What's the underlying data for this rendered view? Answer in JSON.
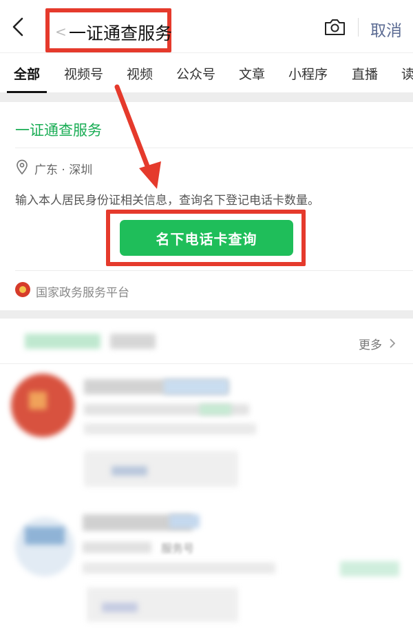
{
  "topbar": {
    "query_mini": "<",
    "query": "一证通查服务",
    "cancel": "取消",
    "icons": [
      "back-icon",
      "camera-icon"
    ]
  },
  "tabs": [
    {
      "label": "全部",
      "active": true
    },
    {
      "label": "视频号",
      "active": false
    },
    {
      "label": "视频",
      "active": false
    },
    {
      "label": "公众号",
      "active": false
    },
    {
      "label": "文章",
      "active": false
    },
    {
      "label": "小程序",
      "active": false
    },
    {
      "label": "直播",
      "active": false
    },
    {
      "label": "读",
      "active": false
    }
  ],
  "service_card": {
    "title": "一证通查服务",
    "location": "广东 · 深圳",
    "description": "输入本人居民身份证相关信息，查询名下登记电话卡数量。",
    "cta": "名下电话卡查询",
    "provider": "国家政务服务平台"
  },
  "results": {
    "more_label": "更多",
    "partial_text": "服务号"
  },
  "colors": {
    "accent_green": "#1fbe5a",
    "title_green": "#1aad55",
    "highlight_red": "#e53a2c",
    "cancel_blue": "#5b6b93"
  }
}
